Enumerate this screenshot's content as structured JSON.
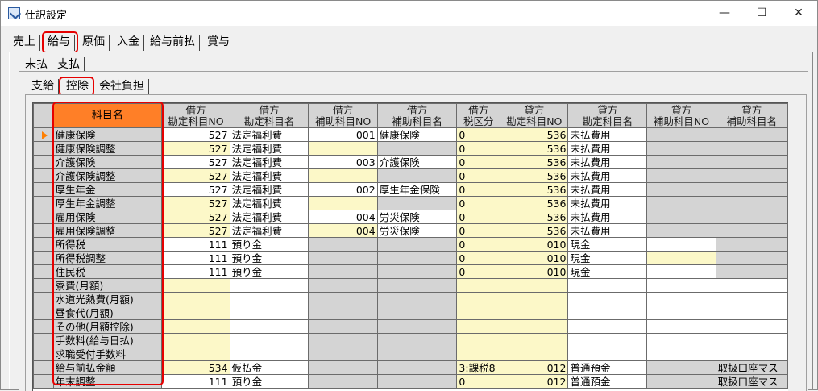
{
  "window": {
    "title": "仕訳設定",
    "minimize": "—",
    "maximize": "☐",
    "close": "✕"
  },
  "main_tabs": [
    "売上",
    "給与",
    "原価",
    "入金",
    "給与前払",
    "賞与"
  ],
  "sub_tabs": [
    "未払",
    "支払"
  ],
  "inner_tabs": [
    "支給",
    "控除",
    "会社負担"
  ],
  "selected": {
    "main_tab": "給与",
    "sub_tab": "未払",
    "inner_tab": "控除"
  },
  "colors": {
    "highlight_border": "#e60000",
    "header_accent": "#ff7f27",
    "input_cell": "#fcf8c8",
    "readonly_cell": "#d4d4d4"
  },
  "grid": {
    "columns": [
      [
        "科目名"
      ],
      [
        "借方",
        "勘定科目NO"
      ],
      [
        "借方",
        "勘定科目名"
      ],
      [
        "借方",
        "補助科目NO"
      ],
      [
        "借方",
        "補助科目名"
      ],
      [
        "借方",
        "税区分"
      ],
      [
        "貸方",
        "勘定科目NO"
      ],
      [
        "貸方",
        "勘定科目名"
      ],
      [
        "貸方",
        "補助科目NO"
      ],
      [
        "貸方",
        "補助科目名"
      ]
    ],
    "rows": [
      [
        "健康保険",
        "527",
        "法定福利費",
        "001",
        "健康保険",
        "0",
        "536",
        "未払費用",
        "",
        ""
      ],
      [
        "健康保険調整",
        "527",
        "法定福利費",
        "",
        "",
        "0",
        "536",
        "未払費用",
        "",
        ""
      ],
      [
        "介護保険",
        "527",
        "法定福利費",
        "003",
        "介護保険",
        "0",
        "536",
        "未払費用",
        "",
        ""
      ],
      [
        "介護保険調整",
        "527",
        "法定福利費",
        "",
        "",
        "0",
        "536",
        "未払費用",
        "",
        ""
      ],
      [
        "厚生年金",
        "527",
        "法定福利費",
        "002",
        "厚生年金保険",
        "0",
        "536",
        "未払費用",
        "",
        ""
      ],
      [
        "厚生年金調整",
        "527",
        "法定福利費",
        "",
        "",
        "0",
        "536",
        "未払費用",
        "",
        ""
      ],
      [
        "雇用保険",
        "527",
        "法定福利費",
        "004",
        "労災保険",
        "0",
        "536",
        "未払費用",
        "",
        ""
      ],
      [
        "雇用保険調整",
        "527",
        "法定福利費",
        "004",
        "労災保険",
        "0",
        "536",
        "未払費用",
        "",
        ""
      ],
      [
        "所得税",
        "111",
        "預り金",
        "",
        "",
        "0",
        "010",
        "現金",
        "",
        ""
      ],
      [
        "所得税調整",
        "111",
        "預り金",
        "",
        "",
        "0",
        "010",
        "現金",
        "",
        ""
      ],
      [
        "住民税",
        "111",
        "預り金",
        "",
        "",
        "0",
        "010",
        "現金",
        "",
        ""
      ],
      [
        "寮費(月額)",
        "",
        "",
        "",
        "",
        "",
        "",
        "",
        "",
        ""
      ],
      [
        "水道光熱費(月額)",
        "",
        "",
        "",
        "",
        "",
        "",
        "",
        "",
        ""
      ],
      [
        "昼食代(月額)",
        "",
        "",
        "",
        "",
        "",
        "",
        "",
        "",
        ""
      ],
      [
        "その他(月額控除)",
        "",
        "",
        "",
        "",
        "",
        "",
        "",
        "",
        ""
      ],
      [
        "手数料(給与日払)",
        "",
        "",
        "",
        "",
        "",
        "",
        "",
        "",
        ""
      ],
      [
        "求職受付手数料",
        "",
        "",
        "",
        "",
        "",
        "",
        "",
        "",
        ""
      ],
      [
        "給与前払金額",
        "534",
        "仮払金",
        "",
        "",
        "3:課税8",
        "012",
        "普通預金",
        "",
        "取扱口座マス"
      ],
      [
        "年末調整",
        "111",
        "預り金",
        "",
        "",
        "0",
        "012",
        "普通預金",
        "",
        "取扱口座マス"
      ]
    ]
  }
}
